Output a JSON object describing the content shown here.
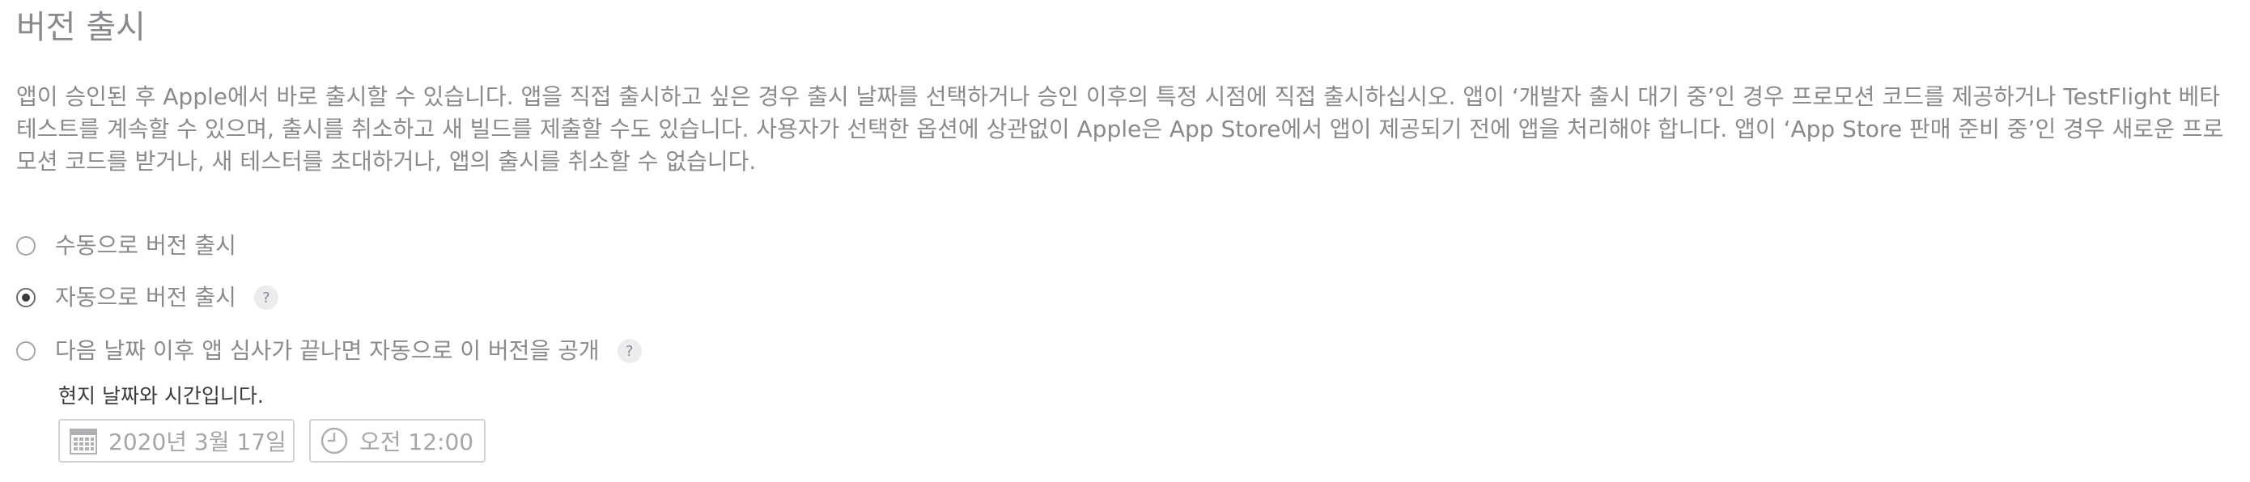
{
  "section": {
    "title": "버전 출시",
    "description": "앱이 승인된 후 Apple에서 바로 출시할 수 있습니다. 앱을 직접 출시하고 싶은 경우 출시 날짜를 선택하거나 승인 이후의 특정 시점에 직접 출시하십시오. 앱이 ‘개발자 출시 대기 중’인 경우 프로모션 코드를 제공하거나 TestFlight 베타 테스트를 계속할 수 있으며, 출시를 취소하고 새 빌드를 제출할 수도 있습니다. 사용자가 선택한 옵션에 상관없이 Apple은 App Store에서 앱이 제공되기 전에 앱을 처리해야 합니다. 앱이 ‘App Store 판매 준비 중’인 경우 새로운 프로모션 코드를 받거나, 새 테스터를 초대하거나, 앱의 출시를 취소할 수 없습니다."
  },
  "release_options": {
    "selected": "automatic",
    "manual_label": "수동으로 버전 출시",
    "automatic_label": "자동으로 버전 출시",
    "scheduled_label": "다음 날짜 이후 앱 심사가 끝나면 자동으로 이 버전을 공개",
    "help_glyph": "?"
  },
  "schedule": {
    "local_time_note": "현지 날짜와 시간입니다.",
    "date_value": "2020년 3월 17일",
    "time_value": "오전 12:00",
    "date_icon": "calendar-icon",
    "time_icon": "clock-icon"
  },
  "colors": {
    "text_muted": "#8a8a8e",
    "text_dark": "#3a3a3c",
    "field_border": "#d1d1d6",
    "help_bg": "#ececee"
  }
}
